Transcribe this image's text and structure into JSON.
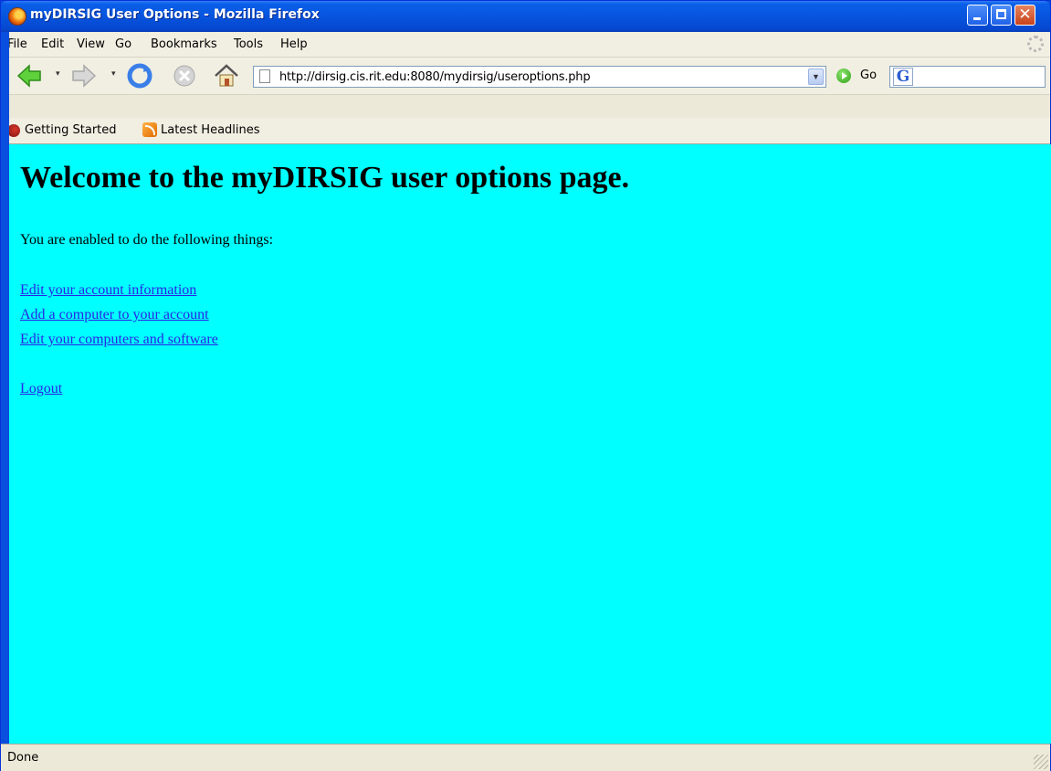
{
  "window": {
    "title": "myDIRSIG User Options - Mozilla Firefox"
  },
  "menu": [
    {
      "label": "File"
    },
    {
      "label": "Edit"
    },
    {
      "label": "View"
    },
    {
      "label": "Go"
    },
    {
      "label": "Bookmarks"
    },
    {
      "label": "Tools"
    },
    {
      "label": "Help"
    }
  ],
  "toolbar": {
    "url": "http://dirsig.cis.rit.edu:8080/mydirsig/useroptions.php",
    "go_label": "Go",
    "search_engine_glyph": "G",
    "search_value": ""
  },
  "bookmarks": [
    {
      "label": "Getting Started",
      "icon": "firefox-icon"
    },
    {
      "label": "Latest Headlines",
      "icon": "rss-icon"
    }
  ],
  "page": {
    "background": "#00ffff",
    "title": "Welcome to the myDIRSIG user options page.",
    "intro": "You are enabled to do the following things:",
    "links": [
      {
        "label": "Edit your account information"
      },
      {
        "label": "Add a computer to your account"
      },
      {
        "label": "Edit your computers and software"
      }
    ],
    "logout": "Logout"
  },
  "status": {
    "text": "Done"
  },
  "colors": {
    "link": "#2a25e6",
    "titlebar": "#0754de"
  }
}
